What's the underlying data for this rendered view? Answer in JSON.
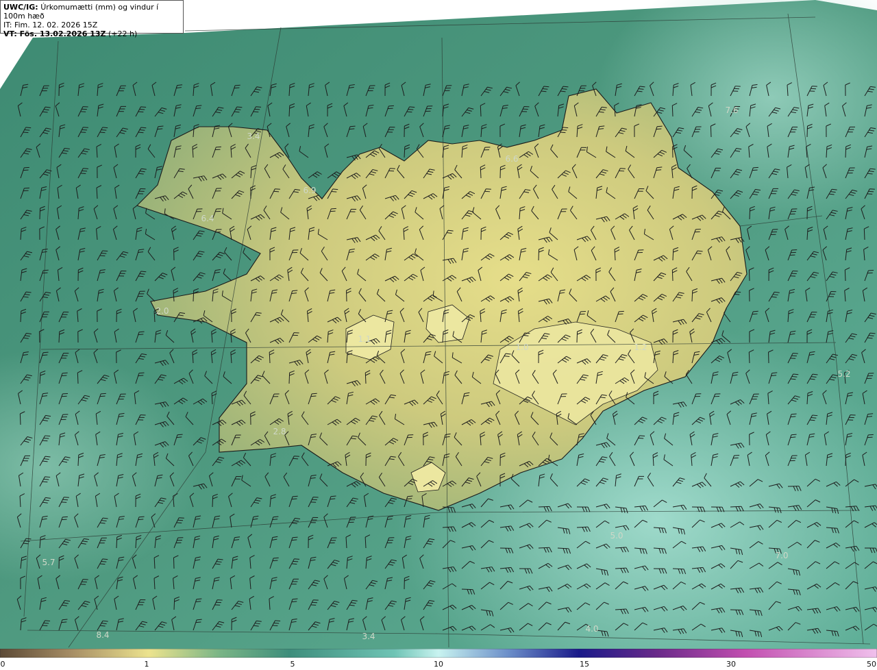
{
  "header": {
    "model": "UWC/IG:",
    "title": "Úrkomumætti (mm) og vindur í 100m hæð",
    "init_time": "IT: Fim. 12. 02. 2026 15Z",
    "valid_prefix": "VT: Fös. 13.02.2026 13Z",
    "valid_suffix": "(+22 h)"
  },
  "map_labels": [
    "3.4",
    "6.6",
    "7.6",
    "6.9",
    "6.4",
    "2.0",
    "1.1",
    "1.0",
    "1.2",
    "5.2",
    "2.8",
    "7.0",
    "5.7",
    "8.4",
    "3.4",
    "4.0",
    "5.0"
  ],
  "colorbar": {
    "ticks": [
      "0",
      "1",
      "5",
      "10",
      "15",
      "30",
      "50"
    ]
  },
  "colors": {
    "land_high": "#e2db86",
    "land_mid": "#bcc07a",
    "sea": "#3f8b74",
    "sea_light": "#8fcfbf"
  }
}
